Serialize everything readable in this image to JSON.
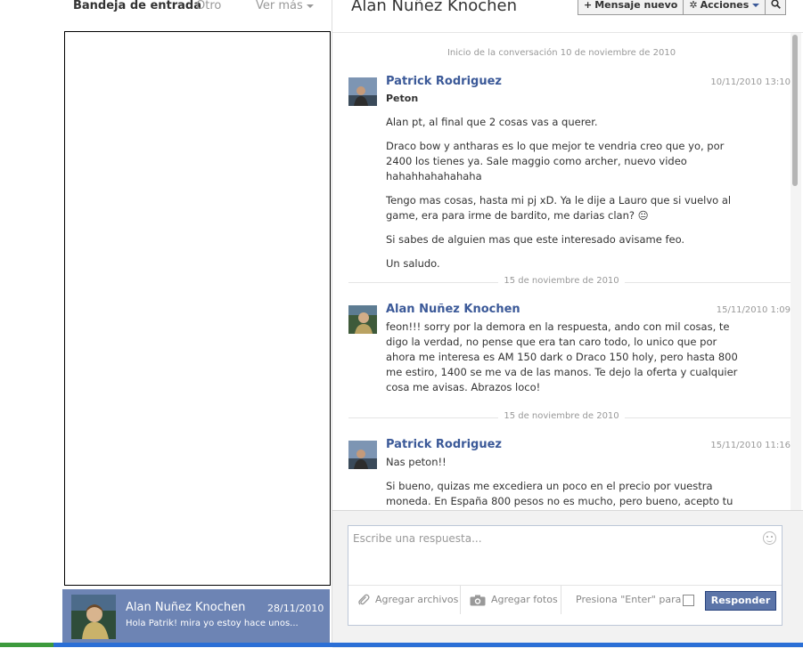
{
  "inbox": {
    "title": "Bandeja de entrada",
    "other_tab": "Otro",
    "more_label": "Ver más",
    "thread": {
      "name": "Alan Nuñez Knochen",
      "date": "28/11/2010",
      "snippet": "Hola Patrik! mira yo estoy hace unos..."
    }
  },
  "conversation": {
    "title": "Alan Nuñez Knochen",
    "new_message_label": "Mensaje nuevo",
    "actions_label": "Acciones",
    "start_label": "Inicio de la conversación 10 de noviembre de 2010",
    "messages": [
      {
        "author": "Patrick Rodriguez",
        "time": "10/11/2010 13:10",
        "subject": "Peton",
        "paragraphs": [
          "Alan pt, al final que 2 cosas vas a querer.",
          "Draco bow y antharas es lo que mejor te vendria creo que yo, por 2400 los tienes ya. Sale maggio como archer, nuevo video hahahhahahahaha",
          "Tengo mas cosas, hasta mi pj xD. Ya le dije a Lauro que si vuelvo al game, era para irme de bardito, me darias clan? 😐",
          "Si sabes de alguien mas que este interesado avisame feo.",
          "Un saludo."
        ]
      },
      {
        "author": "Alan Nuñez Knochen",
        "time": "15/11/2010 1:09",
        "paragraphs": [
          "feon!!! sorry por la demora en la respuesta, ando con mil cosas, te digo la verdad, no pense que era tan caro todo, lo unico que por ahora me interesa es AM 150 dark o Draco 150 holy, pero hasta 800 me estiro, 1400 se me va de las manos. Te dejo la oferta y cualquier cosa me avisas. Abrazos loco!"
        ]
      },
      {
        "author": "Patrick Rodriguez",
        "time": "15/11/2010 11:16",
        "paragraphs": [
          "Nas peton!!",
          "Si bueno, quizas me excediera un poco en el precio por vuestra moneda. En España 800 pesos no es mucho, pero bueno, acepto tu"
        ]
      }
    ],
    "separators": [
      "15 de noviembre de 2010",
      "15 de noviembre de 2010"
    ]
  },
  "composer": {
    "placeholder": "Escribe una respuesta...",
    "attach_label": "Agregar archivos",
    "photos_label": "Agregar fotos",
    "enter_hint": "Presiona \"Enter\" para ...",
    "reply_label": "Responder"
  },
  "colors": {
    "brand": "#3b5998",
    "thread_selected": "#6d84b4",
    "reply_button": "#5b74a8"
  }
}
